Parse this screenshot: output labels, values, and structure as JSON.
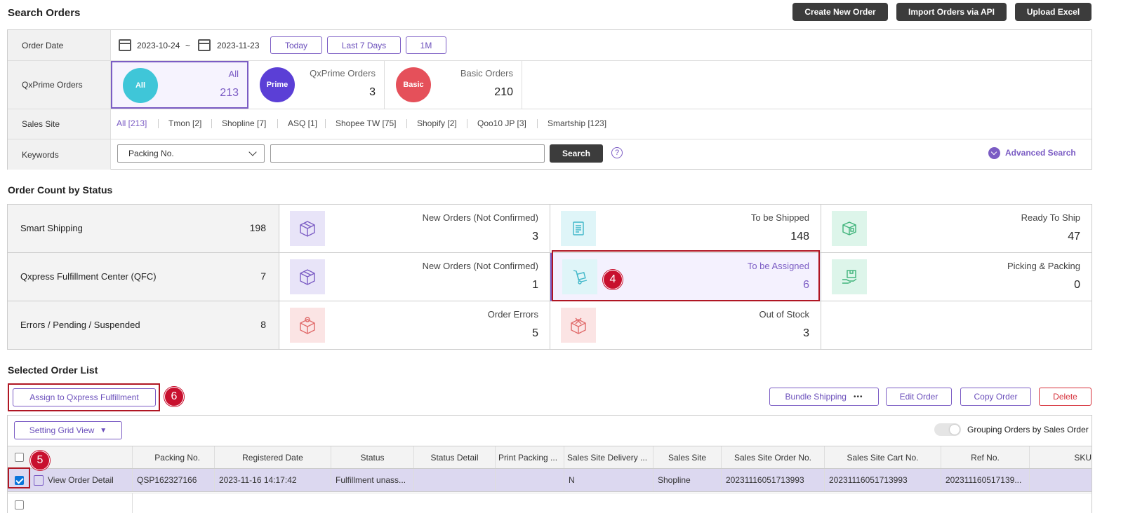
{
  "header": {
    "title": "Search Orders",
    "buttons": {
      "create": "Create New Order",
      "import": "Import Orders via API",
      "upload": "Upload Excel"
    }
  },
  "search_form": {
    "order_date": {
      "label": "Order Date",
      "from": "2023-10-24",
      "separator": "~",
      "to": "2023-11-23",
      "quick": [
        "Today",
        "Last 7 Days",
        "1M"
      ]
    },
    "qxprime": {
      "label": "QxPrime Orders",
      "cards": [
        {
          "badge": "All",
          "label": "All",
          "count": "213",
          "color": "#3fc6d8"
        },
        {
          "badge": "Prime",
          "label": "QxPrime Orders",
          "count": "3",
          "color": "#5b3fd6"
        },
        {
          "badge": "Basic",
          "label": "Basic Orders",
          "count": "210",
          "color": "#e5505a"
        }
      ]
    },
    "sales_site": {
      "label": "Sales Site",
      "sites": [
        "All [213]",
        "Tmon [2]",
        "Shopline [7]",
        "ASQ [1]",
        "Shopee TW [75]",
        "Shopify [2]",
        "Qoo10 JP [3]",
        "Smartship [123]"
      ]
    },
    "keywords": {
      "label": "Keywords",
      "select_value": "Packing No.",
      "input_value": "",
      "search_label": "Search",
      "help": "?",
      "advanced_label": "Advanced Search"
    }
  },
  "status_section": {
    "title": "Order Count by Status",
    "rows": [
      {
        "label": "Smart Shipping",
        "total": "198",
        "cells": [
          {
            "name": "New Orders (Not Confirmed)",
            "count": "3",
            "icon": "box-icon",
            "tint": "#e8e4f8",
            "stroke": "#7b5cc4"
          },
          {
            "name": "To be Shipped",
            "count": "148",
            "icon": "document-icon",
            "tint": "#dff5f8",
            "stroke": "#3fb7c9"
          },
          {
            "name": "Ready To Ship",
            "count": "47",
            "icon": "package-icon",
            "tint": "#ddf5ea",
            "stroke": "#3fb37a"
          }
        ]
      },
      {
        "label": "Qxpress Fulfillment Center (QFC)",
        "total": "7",
        "cells": [
          {
            "name": "New Orders (Not Confirmed)",
            "count": "1",
            "icon": "box-icon",
            "tint": "#e8e4f8",
            "stroke": "#7b5cc4"
          },
          {
            "name": "To be Assigned",
            "count": "6",
            "icon": "hand-truck-icon",
            "tint": "#dff5f8",
            "stroke": "#3fb7c9"
          },
          {
            "name": "Picking & Packing",
            "count": "0",
            "icon": "picking-icon",
            "tint": "#ddf5ea",
            "stroke": "#3fb37a"
          }
        ]
      },
      {
        "label": "Errors / Pending / Suspended",
        "total": "8",
        "cells": [
          {
            "name": "Order Errors",
            "count": "5",
            "icon": "error-box-icon",
            "tint": "#fbe4e4",
            "stroke": "#e06a6a"
          },
          {
            "name": "Out of Stock",
            "count": "3",
            "icon": "out-of-stock-icon",
            "tint": "#fbe4e4",
            "stroke": "#e06a6a"
          }
        ]
      }
    ]
  },
  "order_list": {
    "title": "Selected Order List",
    "assign_label": "Assign to Qxpress Fulfillment",
    "bundle_label": "Bundle Shipping",
    "bundle_more": "•••",
    "edit_label": "Edit Order",
    "copy_label": "Copy Order",
    "delete_label": "Delete",
    "grid_view_label": "Setting Grid View",
    "grid_view_caret": "▼",
    "grouping_label": "Grouping Orders by Sales Order",
    "columns": [
      "Packing No.",
      "Registered Date",
      "Status",
      "Status Detail",
      "Print Packing ...",
      "Sales Site Delivery ...",
      "Sales Site",
      "Sales Site Order No.",
      "Sales Site Cart No.",
      "Ref No.",
      "SKU"
    ],
    "rows": [
      {
        "detail_label": "View Order Detail",
        "checked": true,
        "cells": [
          "QSP162327166",
          "2023-11-16 14:17:42",
          "Fulfillment unass...",
          "",
          "",
          "N",
          "Shopline",
          "20231116051713993",
          "20231116051713993",
          "202311160517139...",
          ""
        ]
      }
    ]
  },
  "annotations": {
    "step4": "4",
    "step5": "5",
    "step6": "6"
  }
}
